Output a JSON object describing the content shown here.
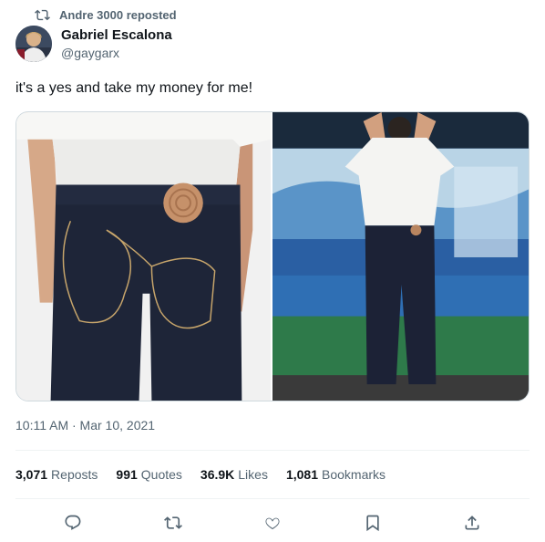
{
  "repost_banner": {
    "text": "Andre 3000 reposted"
  },
  "author": {
    "display_name": "Gabriel Escalona",
    "handle": "@gaygarx"
  },
  "tweet": {
    "text": "it's a yes and take my money for me!"
  },
  "media": [
    {
      "alt": "Back view of dark raw denim jeans with curved contrast stitching and a round leather patch"
    },
    {
      "alt": "Person in white t-shirt and dark jeans standing in front of a blue abstract painting"
    }
  ],
  "timestamp": "10:11 AM · Mar 10, 2021",
  "stats": {
    "reposts": {
      "count": "3,071",
      "label": "Reposts"
    },
    "quotes": {
      "count": "991",
      "label": "Quotes"
    },
    "likes": {
      "count": "36.9K",
      "label": "Likes"
    },
    "bookmarks": {
      "count": "1,081",
      "label": "Bookmarks"
    }
  },
  "actions": [
    "reply-icon",
    "repost-icon",
    "like-icon",
    "bookmark-icon",
    "share-icon"
  ],
  "colors": {
    "text": "#0f1419",
    "secondary": "#536471",
    "border": "#eff3f4"
  }
}
